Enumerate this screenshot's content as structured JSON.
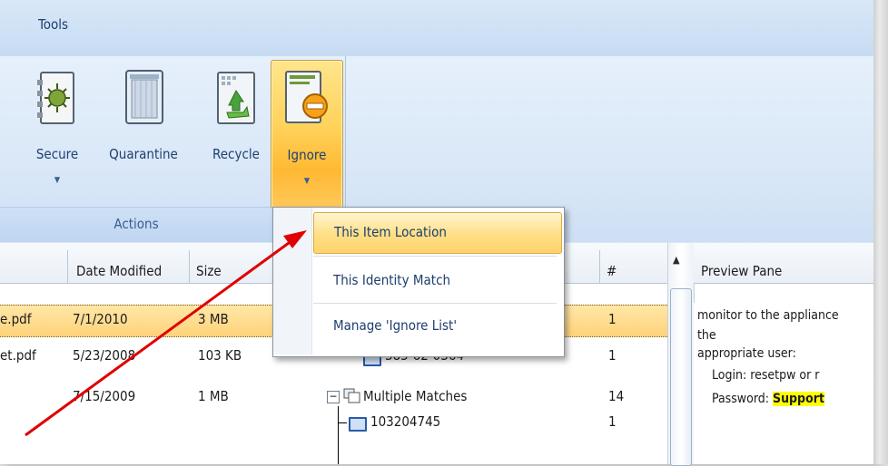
{
  "ribbon": {
    "tab_label": "Tools",
    "group_label": "Actions",
    "buttons": {
      "secure": "Secure",
      "quarantine": "Quarantine",
      "recycle": "Recycle",
      "ignore": "Ignore"
    },
    "dropdown_arrow": "▼"
  },
  "dropdown": {
    "items": [
      "This Item Location",
      "This Identity Match",
      "Manage 'Ignore List'"
    ]
  },
  "grid": {
    "columns": [
      "Date Modified",
      "Size",
      "#"
    ],
    "rows": [
      {
        "name": "e.pdf",
        "date": "7/1/2010",
        "size": "3 MB",
        "match": "",
        "count": "1"
      },
      {
        "name": "et.pdf",
        "date": "5/23/2008",
        "size": "103 KB",
        "match": "385-62-0364",
        "count": "1"
      },
      {
        "name": "",
        "date": "7/15/2009",
        "size": "1 MB",
        "match": "Multiple Matches",
        "count": "14"
      },
      {
        "name": "",
        "date": "",
        "size": "",
        "match": "103204745",
        "count": "1"
      }
    ],
    "tree_toggle": "−",
    "scroll_up": "▲"
  },
  "preview": {
    "title": "Preview Pane",
    "lines": [
      "monitor to the appliance",
      "the",
      "appropriate user:",
      "Login: resetpw  or  r",
      "Password: "
    ],
    "highlight": "Support"
  },
  "colors": {
    "accent": "#ffd25a",
    "arrow": "#e00000",
    "highlight": "#ffff00"
  }
}
